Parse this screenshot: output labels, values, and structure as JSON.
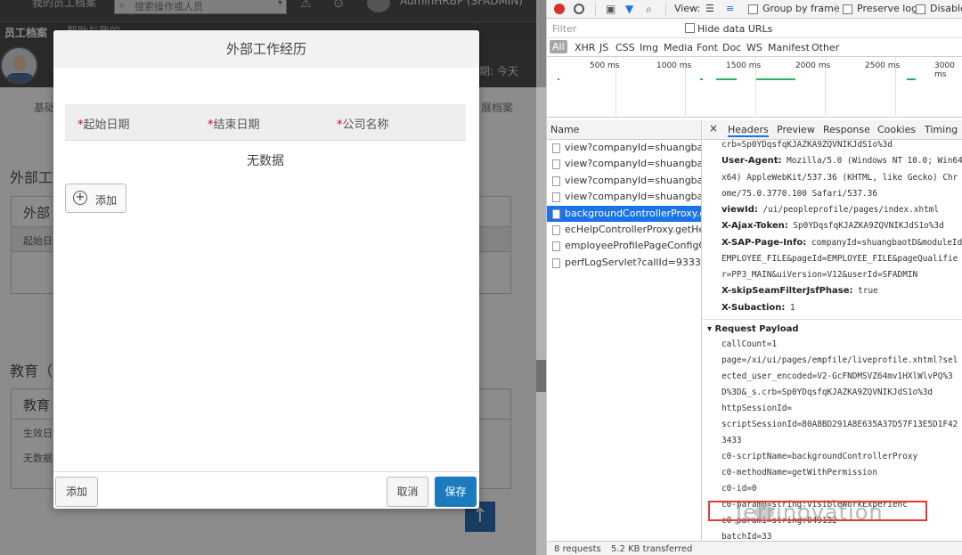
{
  "app": {
    "top_crumb": "我的员工档案",
    "search_placeholder": "搜索操作或人员",
    "user_name": "AdminHRBP (SFADMIN)",
    "subnav_title": "员工档案",
    "subnav_help": "帮助与我的",
    "hero_right": "期: 今天",
    "tab_left": "基础",
    "tab_right": "展档案",
    "section_work_title": "外部工",
    "section_work_panel_head": "外部",
    "section_work_panel_row": "起始日",
    "section_edu_title": "教育（",
    "section_edu_panel_head": "教育",
    "section_edu_panel_row": "生效日",
    "section_edu_panel_empty": "无数据",
    "scroll_top_icon": "arrow-up-icon"
  },
  "modal": {
    "title": "外部工作经历",
    "columns": [
      {
        "required": "*",
        "label": "起始日期"
      },
      {
        "required": "*",
        "label": "结束日期"
      },
      {
        "required": "*",
        "label": "公司名称"
      }
    ],
    "empty_text": "无数据",
    "add_icon": "plus-circle-icon",
    "add_label": "添加",
    "footer_add": "添加",
    "footer_cancel": "取消",
    "footer_save": "保存",
    "save_color": "#1b7bbd"
  },
  "devtools": {
    "view_label": "View:",
    "group_by_frame": "Group by frame",
    "preserve_log": "Preserve log",
    "disable_cache": "Disable",
    "filter_placeholder": "Filter",
    "hide_data_urls": "Hide data URLs",
    "type_filters": [
      "All",
      "XHR",
      "JS",
      "CSS",
      "Img",
      "Media",
      "Font",
      "Doc",
      "WS",
      "Manifest",
      "Other"
    ],
    "timeline_labels": [
      "500 ms",
      "1000 ms",
      "1500 ms",
      "2000 ms",
      "2500 ms",
      "3000 ms"
    ],
    "list_header": "Name",
    "requests": [
      {
        "name": "view?companyId=shuangbaot...",
        "selected": false
      },
      {
        "name": "view?companyId=shuangbaot...",
        "selected": false
      },
      {
        "name": "view?companyId=shuangbaot...",
        "selected": false
      },
      {
        "name": "view?companyId=shuangbaot...",
        "selected": false
      },
      {
        "name": "backgroundControllerProxy.ge...",
        "selected": true
      },
      {
        "name": "ecHelpControllerProxy.getHel...",
        "selected": false
      },
      {
        "name": "employeeProfilePageConfigCo...",
        "selected": false
      },
      {
        "name": "perfLogServlet?callId=933325...",
        "selected": false
      }
    ],
    "detail_tabs": [
      "Headers",
      "Preview",
      "Response",
      "Cookies",
      "Timing"
    ],
    "active_tab": "Headers",
    "header_lines": [
      {
        "key": "",
        "value": "crb=Sp0YDqsfqKJAZKA9ZQVNIKJdS1o%3d"
      },
      {
        "key": "User-Agent:",
        "value": " Mozilla/5.0 (Windows NT 10.0; Win64;"
      },
      {
        "key": "",
        "value": "x64) AppleWebKit/537.36 (KHTML, like Gecko) Chr"
      },
      {
        "key": "",
        "value": "ome/75.0.3770.100 Safari/537.36"
      },
      {
        "key": "viewId:",
        "value": " /ui/peopleprofile/pages/index.xhtml"
      },
      {
        "key": "X-Ajax-Token:",
        "value": " Sp0YDqsfqKJAZKA9ZQVNIKJdS1o%3d"
      },
      {
        "key": "X-SAP-Page-Info:",
        "value": " companyId=shuangbaotD&moduleId="
      },
      {
        "key": "",
        "value": "EMPLOYEE_FILE&pageId=EMPLOYEE_FILE&pageQualifie"
      },
      {
        "key": "",
        "value": "r=PP3_MAIN&uiVersion=V12&userId=SFADMIN"
      },
      {
        "key": "X-skipSeamFilterJsfPhase:",
        "value": " true"
      },
      {
        "key": "X-Subaction:",
        "value": " 1"
      }
    ],
    "payload_title": "▾ Request Payload",
    "payload_lines": [
      "callCount=1",
      "page=/xi/ui/pages/empfile/liveprofile.xhtml?sel",
      "ected_user_encoded=V2-GcFNDMSVZ64mv1HXlWlvPQ%3",
      "D%3D&_s.crb=Sp0YDqsfqKJAZKA9ZQVNIKJdS1o%3d",
      "httpSessionId=",
      "scriptSessionId=80A8BD291A8E635A37D57F13E5D1F42",
      "3433",
      "c0-scriptName=backgroundControllerProxy",
      "c0-methodName=getWithPermission",
      "c0-id=0",
      "c0-param0=string:visibleWorkExperienc",
      "c0-param1=string:049132",
      "batchId=33"
    ],
    "status_requests": "8 requests",
    "status_transferred": "5.2 KB transferred",
    "highlight_color": "#e53935"
  },
  "watermark": "Jerrinovation"
}
